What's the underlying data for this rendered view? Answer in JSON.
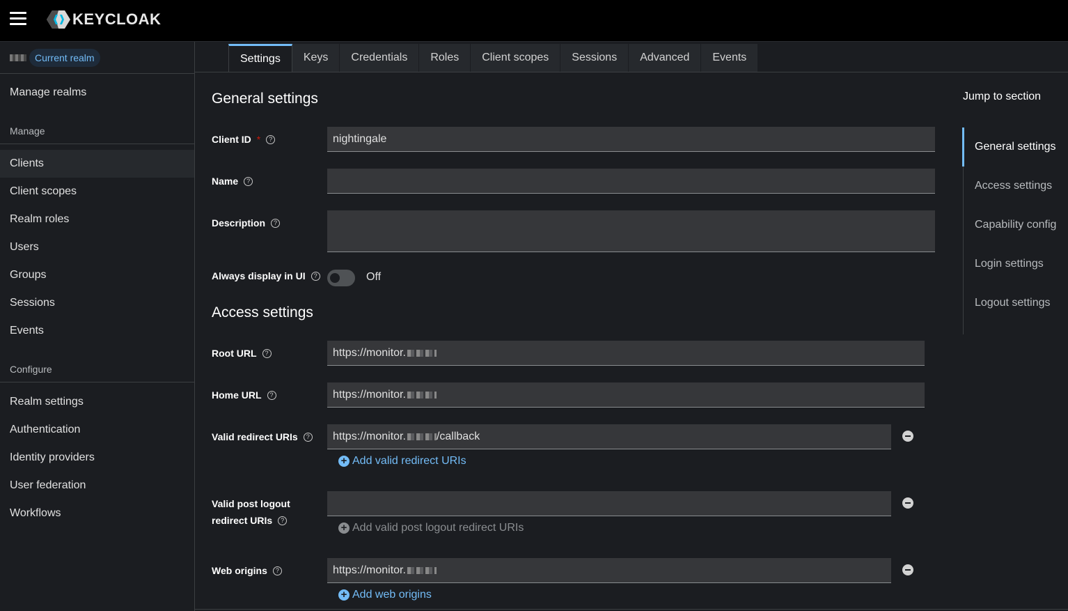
{
  "brand": {
    "name": "KEYCLOAK"
  },
  "realm": {
    "label": "Current realm"
  },
  "sidebar": {
    "manage_realms": "Manage realms",
    "manage_label": "Manage",
    "manage_items": [
      "Clients",
      "Client scopes",
      "Realm roles",
      "Users",
      "Groups",
      "Sessions",
      "Events"
    ],
    "configure_label": "Configure",
    "configure_items": [
      "Realm settings",
      "Authentication",
      "Identity providers",
      "User federation",
      "Workflows"
    ],
    "active": "Clients"
  },
  "tabs": [
    "Settings",
    "Keys",
    "Credentials",
    "Roles",
    "Client scopes",
    "Sessions",
    "Advanced",
    "Events"
  ],
  "active_tab": "Settings",
  "general": {
    "title": "General settings",
    "client_id_label": "Client ID",
    "client_id_required": "*",
    "client_id_value": "nightingale",
    "name_label": "Name",
    "name_value": "",
    "description_label": "Description",
    "description_value": "",
    "always_display_label": "Always display in UI",
    "always_display_state": "Off"
  },
  "access": {
    "title": "Access settings",
    "root_url_label": "Root URL",
    "root_url_value": "https://monitor.",
    "home_url_label": "Home URL",
    "home_url_value": "https://monitor.",
    "redirect_label": "Valid redirect URIs",
    "redirect_value_prefix": "https://monitor.",
    "redirect_value_suffix": "/callback",
    "add_redirect": "Add valid redirect URIs",
    "post_logout_label_1": "Valid post logout",
    "post_logout_label_2": "redirect URIs",
    "post_logout_value": "",
    "add_post_logout": "Add valid post logout redirect URIs",
    "web_origins_label": "Web origins",
    "web_origins_value": "https://monitor.",
    "add_web_origins": "Add web origins"
  },
  "jump": {
    "title": "Jump to section",
    "items": [
      "General settings",
      "Access settings",
      "Capability config",
      "Login settings",
      "Logout settings"
    ],
    "active": "General settings"
  },
  "icons": {
    "help": "help-icon",
    "plus": "plus-circle-icon",
    "minus": "minus-circle-icon",
    "menu": "hamburger-icon"
  },
  "colors": {
    "accent": "#73bcf7",
    "required": "#c9190b",
    "background": "#1b1d21",
    "topbar": "#000000"
  }
}
